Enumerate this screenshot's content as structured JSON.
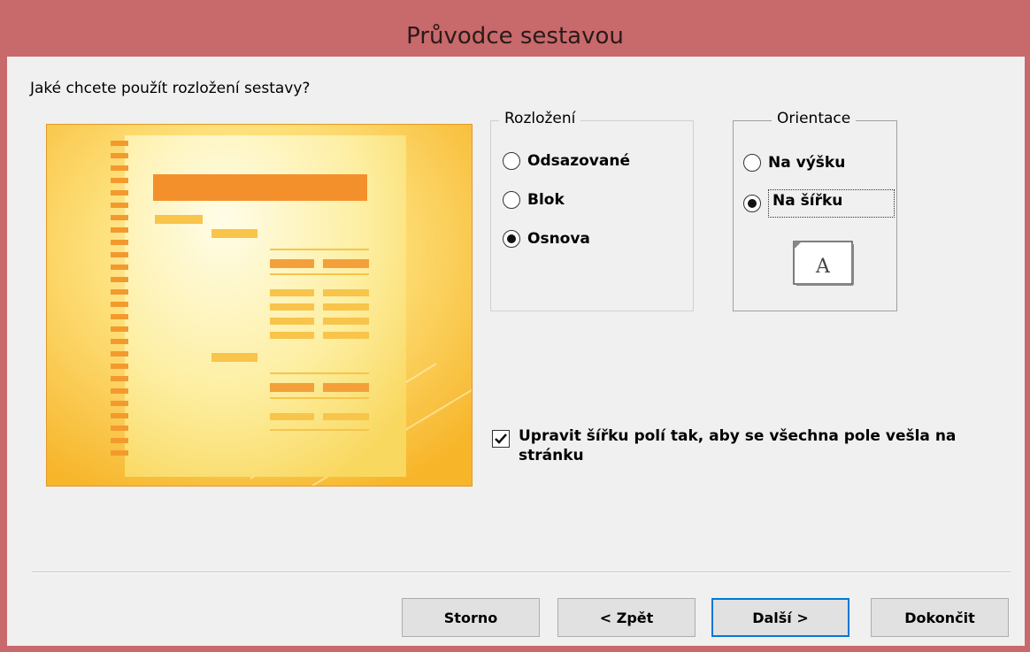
{
  "window": {
    "title": "Průvodce sestavou"
  },
  "question": "Jaké chcete použít rozložení sestavy?",
  "layout_group": {
    "legend": "Rozložení",
    "options": [
      {
        "label": "Odsazované",
        "selected": false
      },
      {
        "label": "Blok",
        "selected": false
      },
      {
        "label": "Osnova",
        "selected": true
      }
    ]
  },
  "orientation_group": {
    "legend": "Orientace",
    "options": [
      {
        "label": "Na výšku",
        "selected": false
      },
      {
        "label": "Na šířku",
        "selected": true
      }
    ],
    "icon_letter": "A"
  },
  "fit_fields": {
    "label": "Upravit šířku polí tak, aby se všechna pole vešla na stránku",
    "checked": true
  },
  "buttons": {
    "cancel": "Storno",
    "back": "< Zpět",
    "next": "Další >",
    "finish": "Dokončit"
  },
  "colors": {
    "titlebar": "#c8696b",
    "dialog_bg": "#f0f0f0",
    "preview_orange": "#f4902c",
    "preview_yellow": "#fde98a",
    "default_button_border": "#0078d7"
  }
}
